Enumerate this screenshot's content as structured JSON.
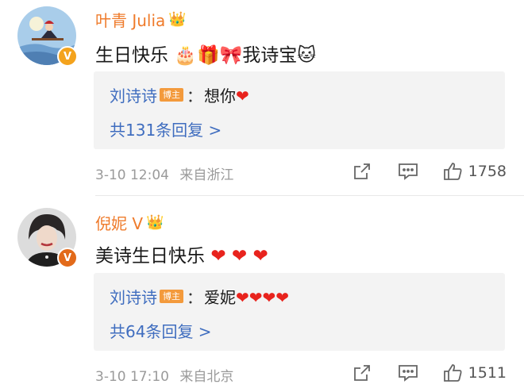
{
  "comments": [
    {
      "name": "叶青 Julia",
      "badge_icon": "crown-icon",
      "text": "生日快乐 🎂🎁🎀我诗宝🐱",
      "reply": {
        "replier": "刘诗诗",
        "tag": "博主",
        "colon": "：",
        "content": "想你❤"
      },
      "more": "共131条回复 >",
      "time": "3-10 12:04",
      "location": "来自浙江",
      "likes": "1758"
    },
    {
      "name": "倪妮 V",
      "badge_icon": "crown-icon",
      "text": "美诗生日快乐 ❤ ❤ ❤",
      "reply": {
        "replier": "刘诗诗",
        "tag": "博主",
        "colon": "：",
        "content": "爱妮❤❤❤❤"
      },
      "more": "共64条回复 >",
      "time": "3-10 17:10",
      "location": "来自北京",
      "likes": "1511"
    }
  ],
  "colors": {
    "name": "#ef7b2b",
    "link": "#3f6dbf",
    "tag": "#f39a3c",
    "heart": "#e8231d"
  }
}
